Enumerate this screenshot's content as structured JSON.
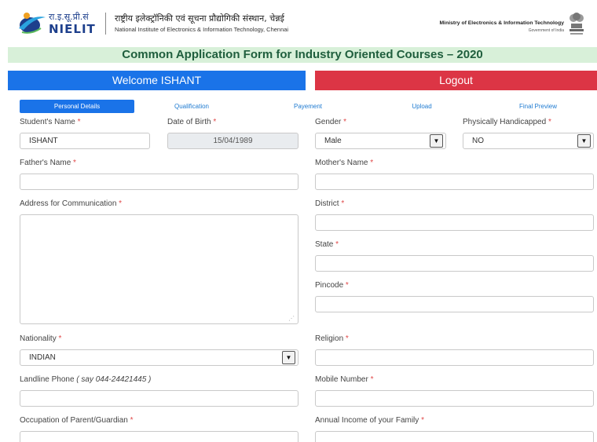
{
  "header": {
    "logo_hindi_abbr": "रा.इ.सू.प्री.सं",
    "logo_abbr": "NIELIT",
    "institute_hindi": "राष्ट्रीय इलेक्ट्रॉनिकी एवं सूचना प्रौद्योगिकी संस्थान, चेन्नई",
    "institute_english": "National Institute of Electronics & Information Technology, Chennai",
    "ministry": "Ministry of Electronics & Information Technology",
    "government": "Government of India",
    "logo_icon": "nielit-swoosh-icon",
    "emblem_icon": "national-emblem-icon"
  },
  "form_title": "Common Application Form for Industry Oriented Courses – 2020",
  "welcome_label": "Welcome ISHANT",
  "logout_label": "Logout",
  "tabs": [
    {
      "label": "Personal Details",
      "active": true
    },
    {
      "label": "Qualification",
      "active": false
    },
    {
      "label": "Payement",
      "active": false
    },
    {
      "label": "Upload",
      "active": false
    },
    {
      "label": "Final Preview",
      "active": false
    }
  ],
  "required_marker": "*",
  "form": {
    "student_name": {
      "label": "Student's Name",
      "value": "ISHANT"
    },
    "dob": {
      "label": "Date of Birth",
      "value": "15/04/1989"
    },
    "gender": {
      "label": "Gender",
      "value": "Male"
    },
    "physically_handicapped": {
      "label": "Physically Handicapped",
      "value": "NO"
    },
    "father_name": {
      "label": "Father's Name",
      "value": ""
    },
    "mother_name": {
      "label": "Mother's Name",
      "value": ""
    },
    "address": {
      "label": "Address for Communication",
      "value": ""
    },
    "district": {
      "label": "District",
      "value": ""
    },
    "state": {
      "label": "State",
      "value": ""
    },
    "pincode": {
      "label": "Pincode",
      "value": ""
    },
    "nationality": {
      "label": "Nationality",
      "value": "INDIAN"
    },
    "religion": {
      "label": "Religion",
      "value": ""
    },
    "landline": {
      "label": "Landline Phone",
      "hint": "( say 044-24421445 )",
      "value": ""
    },
    "mobile": {
      "label": "Mobile Number",
      "value": ""
    },
    "occupation": {
      "label": "Occupation of Parent/Guardian",
      "value": ""
    },
    "annual_income": {
      "label": "Annual Income of your Family",
      "value": ""
    }
  },
  "icons": {
    "select_arrow": "chevron-down-icon",
    "resize": "resize-grip-icon"
  },
  "colors": {
    "primary": "#1a73e8",
    "danger": "#dc3545",
    "title_bg": "#d8f0d9",
    "title_text": "#1f5e3d",
    "required": "#e04848",
    "disabled_bg": "#e9ecef"
  }
}
